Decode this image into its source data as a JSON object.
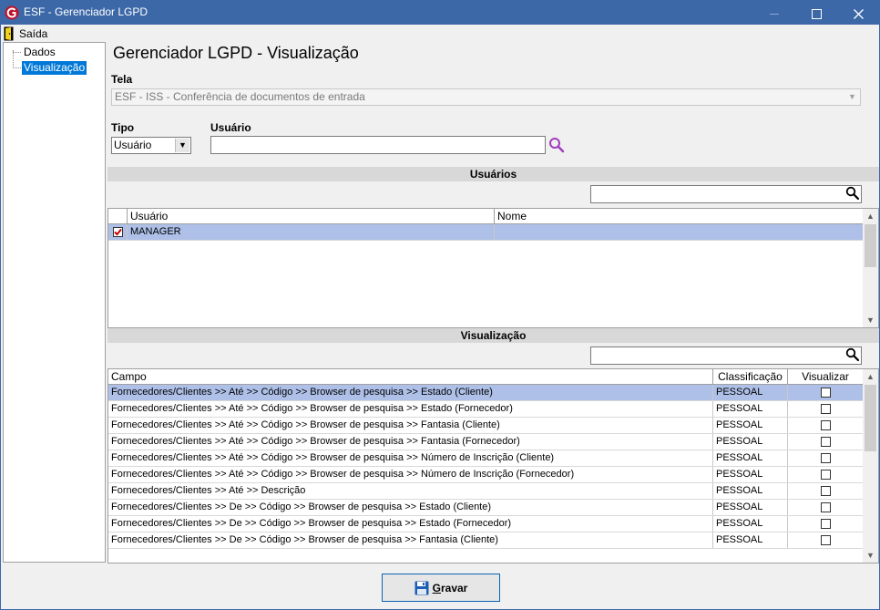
{
  "window": {
    "title": "ESF - Gerenciador LGPD"
  },
  "menu": {
    "exit_label": "Saída"
  },
  "tree": {
    "items": [
      "Dados",
      "Visualização"
    ],
    "selected": "Visualização"
  },
  "page": {
    "heading": "Gerenciador LGPD - Visualização"
  },
  "screen_field": {
    "label": "Tela",
    "value": "ESF - ISS - Conferência de documentos de entrada"
  },
  "type_field": {
    "label": "Tipo",
    "value": "Usuário"
  },
  "user_field": {
    "label": "Usuário",
    "value": ""
  },
  "users_section": {
    "title": "Usuários",
    "search_value": "",
    "columns": [
      "Usuário",
      "Nome"
    ],
    "rows": [
      {
        "checked": true,
        "user": "MANAGER",
        "name": ""
      }
    ]
  },
  "view_section": {
    "title": "Visualização",
    "search_value": "",
    "columns": [
      "Campo",
      "Classificação",
      "Visualizar"
    ],
    "rows": [
      {
        "field": "Fornecedores/Clientes >> Até >> Código >> Browser de pesquisa >> Estado (Cliente)",
        "classification": "PESSOAL",
        "view": false
      },
      {
        "field": "Fornecedores/Clientes >> Até >> Código >> Browser de pesquisa >> Estado (Fornecedor)",
        "classification": "PESSOAL",
        "view": false
      },
      {
        "field": "Fornecedores/Clientes >> Até >> Código >> Browser de pesquisa >> Fantasia (Cliente)",
        "classification": "PESSOAL",
        "view": false
      },
      {
        "field": "Fornecedores/Clientes >> Até >> Código >> Browser de pesquisa >> Fantasia (Fornecedor)",
        "classification": "PESSOAL",
        "view": false
      },
      {
        "field": "Fornecedores/Clientes >> Até >> Código >> Browser de pesquisa >> Número de Inscrição (Cliente)",
        "classification": "PESSOAL",
        "view": false
      },
      {
        "field": "Fornecedores/Clientes >> Até >> Código >> Browser de pesquisa >> Número de Inscrição (Fornecedor)",
        "classification": "PESSOAL",
        "view": false
      },
      {
        "field": "Fornecedores/Clientes >> Até >> Descrição",
        "classification": "PESSOAL",
        "view": false
      },
      {
        "field": "Fornecedores/Clientes >> De >> Código >> Browser de pesquisa >> Estado (Cliente)",
        "classification": "PESSOAL",
        "view": false
      },
      {
        "field": "Fornecedores/Clientes >> De >> Código >> Browser de pesquisa >> Estado (Fornecedor)",
        "classification": "PESSOAL",
        "view": false
      },
      {
        "field": "Fornecedores/Clientes >> De >> Código >> Browser de pesquisa >> Fantasia (Cliente)",
        "classification": "PESSOAL",
        "view": false
      }
    ]
  },
  "footer": {
    "save_label": "Gravar",
    "save_mnemonic": "G",
    "save_rest": "ravar"
  },
  "icons": {
    "app": "app-logo-icon",
    "exit": "exit-door-icon",
    "search": "magnifier-icon",
    "save": "floppy-disk-icon"
  },
  "colors": {
    "titlebar": "#3c68a8",
    "selection": "#aec0e8",
    "section_bar": "#d8d8d8",
    "accent_check": "#c00000"
  }
}
